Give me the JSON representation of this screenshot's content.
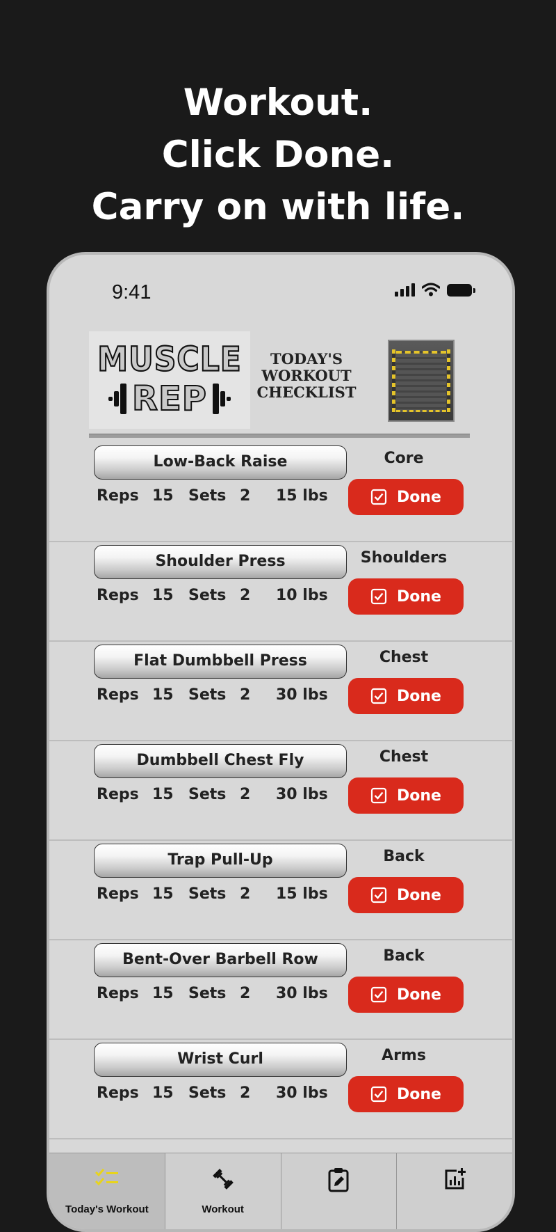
{
  "tagline": [
    "Workout.",
    "Click Done.",
    "Carry on with life."
  ],
  "status_bar": {
    "time": "9:41"
  },
  "header": {
    "logo_line1": "MUSCLE",
    "logo_line2": "REP",
    "title_lines": [
      "TODAY'S",
      "WORKOUT",
      "CHECKLIST"
    ]
  },
  "labels": {
    "reps": "Reps",
    "sets": "Sets",
    "done": "Done"
  },
  "workouts": [
    {
      "name": "Low-Back Raise",
      "muscle": "Core",
      "reps": "15",
      "sets": "2",
      "weight": "15 lbs"
    },
    {
      "name": "Shoulder Press",
      "muscle": "Shoulders",
      "reps": "15",
      "sets": "2",
      "weight": "10 lbs"
    },
    {
      "name": "Flat Dumbbell Press",
      "muscle": "Chest",
      "reps": "15",
      "sets": "2",
      "weight": "30 lbs"
    },
    {
      "name": "Dumbbell Chest Fly",
      "muscle": "Chest",
      "reps": "15",
      "sets": "2",
      "weight": "30 lbs"
    },
    {
      "name": "Trap Pull-Up",
      "muscle": "Back",
      "reps": "15",
      "sets": "2",
      "weight": "15 lbs"
    },
    {
      "name": "Bent-Over Barbell Row",
      "muscle": "Back",
      "reps": "15",
      "sets": "2",
      "weight": "30 lbs"
    },
    {
      "name": "Wrist Curl",
      "muscle": "Arms",
      "reps": "15",
      "sets": "2",
      "weight": "30 lbs"
    }
  ],
  "tabs": [
    {
      "label": "Today's Workout",
      "icon": "checklist-icon",
      "active": true
    },
    {
      "label": "Workout",
      "icon": "dumbbell-icon",
      "active": false
    },
    {
      "label": "",
      "icon": "clipboard-edit-icon",
      "active": false
    },
    {
      "label": "",
      "icon": "chart-add-icon",
      "active": false
    }
  ],
  "colors": {
    "background": "#1a1a1a",
    "phone": "#d8d8d8",
    "done_button": "#d92a1c",
    "active_tab_icon": "#e8d41c"
  }
}
